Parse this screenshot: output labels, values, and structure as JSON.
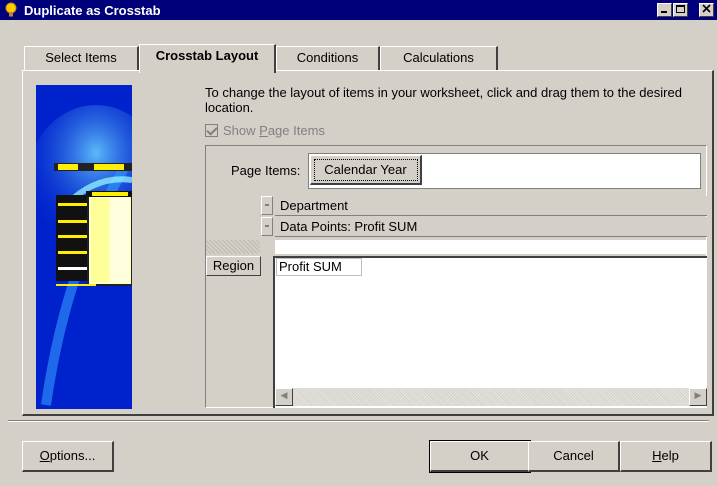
{
  "window": {
    "title": "Duplicate as Crosstab",
    "icon": "lightbulb-icon",
    "controls": [
      "minimize",
      "maximize",
      "close"
    ]
  },
  "tabs": [
    {
      "label": "Select Items",
      "active": false
    },
    {
      "label": "Crosstab Layout",
      "active": true
    },
    {
      "label": "Conditions",
      "active": false
    },
    {
      "label": "Calculations",
      "active": false
    }
  ],
  "instruction": "To change the layout of items in your worksheet, click and drag them to the desired location.",
  "show_page_items": {
    "label_prefix": "Show ",
    "label_hotkey": "P",
    "label_suffix": "age Items",
    "checked": true,
    "enabled": false
  },
  "layout": {
    "page_items_label": "Page Items:",
    "page_items": [
      "Calendar Year"
    ],
    "column_items": [
      "Department",
      "Data Points: Profit SUM"
    ],
    "row_items": [
      "Region"
    ],
    "data_cell": "Profit SUM"
  },
  "buttons": {
    "options": {
      "hotkey": "O",
      "rest": "ptions..."
    },
    "ok": "OK",
    "cancel": "Cancel",
    "help": {
      "hotkey": "H",
      "rest": "elp"
    }
  },
  "colors": {
    "titlebar": "#00007b",
    "dialog_bg": "#d4d0c8",
    "illustration_blue": "#0022cc"
  }
}
